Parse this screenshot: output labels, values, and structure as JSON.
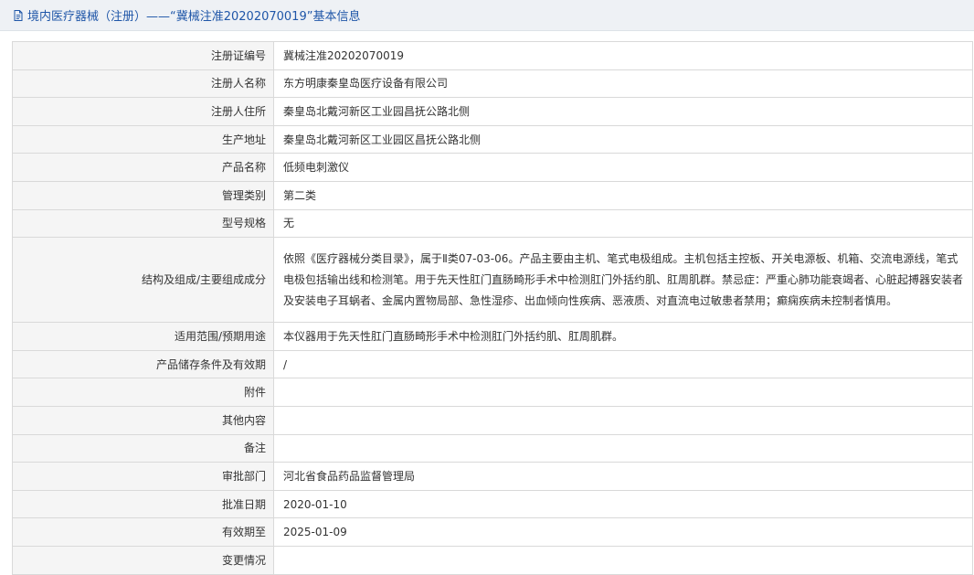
{
  "header": {
    "title": "境内医疗器械（注册）——“冀械注准20202070019”基本信息",
    "icon": "document-icon"
  },
  "rows": [
    {
      "label": "注册证编号",
      "value": "冀械注准20202070019"
    },
    {
      "label": "注册人名称",
      "value": "东方明康秦皇岛医疗设备有限公司"
    },
    {
      "label": "注册人住所",
      "value": "秦皇岛北戴河新区工业园昌抚公路北侧"
    },
    {
      "label": "生产地址",
      "value": "秦皇岛北戴河新区工业园区昌抚公路北侧"
    },
    {
      "label": "产品名称",
      "value": "低频电刺激仪"
    },
    {
      "label": "管理类别",
      "value": "第二类"
    },
    {
      "label": "型号规格",
      "value": "无"
    },
    {
      "label": "结构及组成/主要组成成分",
      "value": "依照《医疗器械分类目录》，属于Ⅱ类07-03-06。产品主要由主机、笔式电极组成。主机包括主控板、开关电源板、机箱、交流电源线，笔式电极包括输出线和检测笔。用于先天性肛门直肠畸形手术中检测肛门外括约肌、肛周肌群。禁忌症：严重心肺功能衰竭者、心脏起搏器安装者及安装电子耳蜗者、金属内置物局部、急性湿疹、出血倾向性疾病、恶液质、对直流电过敏患者禁用；癫痫疾病未控制者慎用。"
    },
    {
      "label": "适用范围/预期用途",
      "value": "本仪器用于先天性肛门直肠畸形手术中检测肛门外括约肌、肛周肌群。"
    },
    {
      "label": "产品储存条件及有效期",
      "value": "/"
    },
    {
      "label": "附件",
      "value": ""
    },
    {
      "label": "其他内容",
      "value": ""
    },
    {
      "label": "备注",
      "value": ""
    },
    {
      "label": "审批部门",
      "value": "河北省食品药品监督管理局"
    },
    {
      "label": "批准日期",
      "value": "2020-01-10"
    },
    {
      "label": "有效期至",
      "value": "2025-01-09"
    },
    {
      "label": "变更情况",
      "value": ""
    }
  ]
}
